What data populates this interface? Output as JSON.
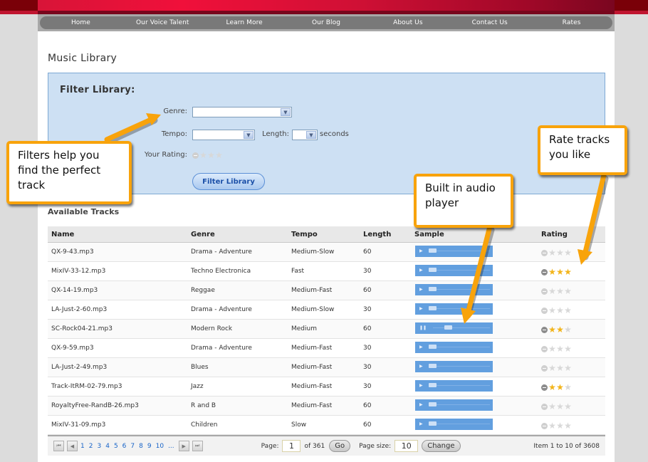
{
  "nav": {
    "items": [
      "Home",
      "Our Voice Talent",
      "Learn More",
      "Our Blog",
      "About Us",
      "Contact Us",
      "Rates"
    ]
  },
  "page_title": "Music Library",
  "filter": {
    "title": "Filter Library:",
    "genre_label": "Genre:",
    "genre_value": "",
    "tempo_label": "Tempo:",
    "tempo_value": "",
    "length_label": "Length:",
    "length_value": "",
    "length_unit": "seconds",
    "rating_label": "Your Rating:",
    "rating_value": 0,
    "rating_max": 3,
    "button_label": "Filter Library"
  },
  "tracks": {
    "title": "Available Tracks",
    "columns": [
      "Name",
      "Genre",
      "Tempo",
      "Length",
      "Sample",
      "Rating"
    ],
    "rows": [
      {
        "name": "QX-9-43.mp3",
        "genre": "Drama - Adventure",
        "tempo": "Medium-Slow",
        "length": "60",
        "playing": false,
        "rating": 0
      },
      {
        "name": "MixIV-33-12.mp3",
        "genre": "Techno Electronica",
        "tempo": "Fast",
        "length": "30",
        "playing": false,
        "rating": 3
      },
      {
        "name": "QX-14-19.mp3",
        "genre": "Reggae",
        "tempo": "Medium-Fast",
        "length": "60",
        "playing": false,
        "rating": 0
      },
      {
        "name": "LA-Just-2-60.mp3",
        "genre": "Drama - Adventure",
        "tempo": "Medium-Slow",
        "length": "30",
        "playing": false,
        "rating": 0
      },
      {
        "name": "SC-Rock04-21.mp3",
        "genre": "Modern Rock",
        "tempo": "Medium",
        "length": "60",
        "playing": true,
        "rating": 2
      },
      {
        "name": "QX-9-59.mp3",
        "genre": "Drama - Adventure",
        "tempo": "Medium-Fast",
        "length": "30",
        "playing": false,
        "rating": 0
      },
      {
        "name": "LA-Just-2-49.mp3",
        "genre": "Blues",
        "tempo": "Medium-Fast",
        "length": "30",
        "playing": false,
        "rating": 0
      },
      {
        "name": "Track-ItRM-02-79.mp3",
        "genre": "Jazz",
        "tempo": "Medium-Fast",
        "length": "30",
        "playing": false,
        "rating": 2
      },
      {
        "name": "RoyaltyFree-RandB-26.mp3",
        "genre": "R and B",
        "tempo": "Medium-Fast",
        "length": "60",
        "playing": false,
        "rating": 0
      },
      {
        "name": "MixIV-31-09.mp3",
        "genre": "Children",
        "tempo": "Slow",
        "length": "60",
        "playing": false,
        "rating": 0
      }
    ]
  },
  "pager": {
    "pages": [
      "1",
      "2",
      "3",
      "4",
      "5",
      "6",
      "7",
      "8",
      "9",
      "10",
      "..."
    ],
    "page_label": "Page:",
    "page_value": "1",
    "page_of": "of 361",
    "go_label": "Go",
    "size_label": "Page size:",
    "size_value": "10",
    "change_label": "Change",
    "summary": "Item 1 to 10 of 3608"
  },
  "callouts": {
    "filters": "Filters help you find the perfect track",
    "player": "Built in audio player",
    "rate": "Rate tracks you like"
  },
  "colors": {
    "accent_orange": "#f8a30b",
    "header_red": "#f0103a",
    "filter_bg": "#cde0f3",
    "player_blue": "#629fdf",
    "star_gold": "#f2b41a"
  }
}
